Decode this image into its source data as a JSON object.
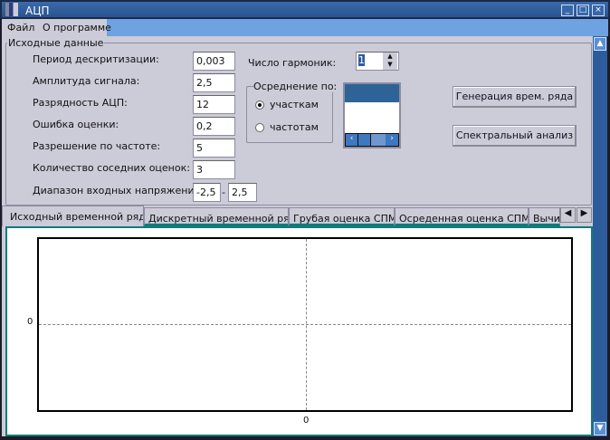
{
  "window": {
    "title": "АЦП"
  },
  "menu": [
    "Файл",
    "О программе"
  ],
  "group_title": "Исходные данные",
  "fields": [
    {
      "label": "Период дескритизации:",
      "value": "0,003"
    },
    {
      "label": "Амплитуда сигнала:",
      "value": "2,5"
    },
    {
      "label": "Разрядность АЦП:",
      "value": "12"
    },
    {
      "label": "Ошибка оценки:",
      "value": "0,2"
    },
    {
      "label": "Разрешение по частоте:",
      "value": "5"
    },
    {
      "label": "Количество соседних оценок:",
      "value": "3"
    }
  ],
  "range": {
    "label": "Диапазон входных напряжений:",
    "min": "-2,5",
    "sep": "-",
    "max": "2,5"
  },
  "harmonics": {
    "label": "Число гармоник:",
    "value": "1"
  },
  "averaging": {
    "title": "Осреднение по:",
    "options": [
      "участкам",
      "частотам"
    ],
    "selected": "участкам"
  },
  "buttons": {
    "generate": "Генерация врем. ряда",
    "spectral": "Спектральный анализ"
  },
  "tabs": [
    "Исходный временной ряд",
    "Дискретный временной ряд",
    "Грубая оценка СПМ",
    "Осреденная оценка СПМ",
    "Вычи"
  ],
  "active_tab": "Исходный временной ряд",
  "chart_data": {
    "type": "line",
    "series": [],
    "x_ticks": [
      "0"
    ],
    "y_ticks": [
      "0"
    ],
    "grid": true
  }
}
